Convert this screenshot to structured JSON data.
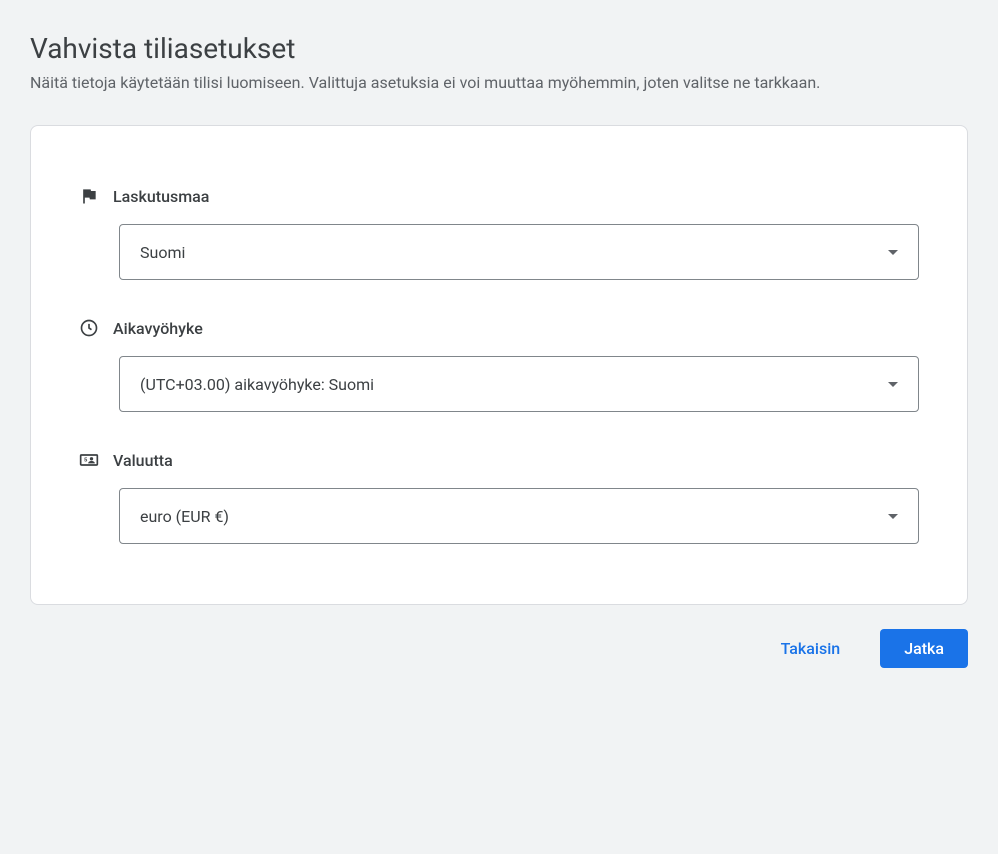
{
  "header": {
    "title": "Vahvista tiliasetukset",
    "subtitle": "Näitä tietoja käytetään tilisi luomiseen. Valittuja asetuksia ei voi muuttaa myöhemmin, joten valitse ne tarkkaan."
  },
  "fields": {
    "billing_country": {
      "label": "Laskutusmaa",
      "value": "Suomi"
    },
    "timezone": {
      "label": "Aikavyöhyke",
      "value": "(UTC+03.00) aikavyöhyke: Suomi"
    },
    "currency": {
      "label": "Valuutta",
      "value": "euro (EUR €)"
    }
  },
  "buttons": {
    "back": "Takaisin",
    "continue": "Jatka"
  }
}
